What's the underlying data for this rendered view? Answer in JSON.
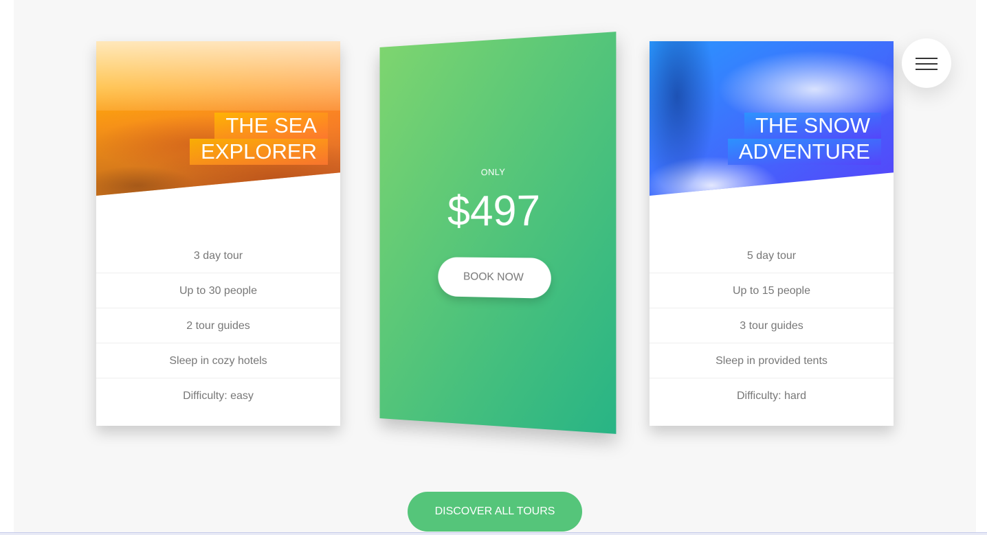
{
  "cards": [
    {
      "heading": [
        "The Sea",
        "Explorer"
      ],
      "details": [
        "3 day tour",
        "Up to 30 people",
        "2 tour guides",
        "Sleep in cozy hotels",
        "Difficulty: easy"
      ],
      "accent": [
        "#ffb900",
        "#ff7730"
      ]
    },
    {
      "heading": [
        "The Snow",
        "Adventure"
      ],
      "details": [
        "5 day tour",
        "Up to 15 people",
        "3 tour guides",
        "Sleep in provided tents",
        "Difficulty: hard"
      ],
      "accent": [
        "#2998ff",
        "#5643fa"
      ]
    }
  ],
  "featured": {
    "price_label": "Only",
    "price": "$497",
    "book_button": "Book now",
    "accent": [
      "#7ed56f",
      "#28b485"
    ]
  },
  "discover_button": "Discover all tours",
  "navigation": {
    "icon": "hamburger-menu-icon"
  },
  "colors": {
    "primary": "#55c57a",
    "background": "#f7f7f7",
    "text": "#777777"
  }
}
